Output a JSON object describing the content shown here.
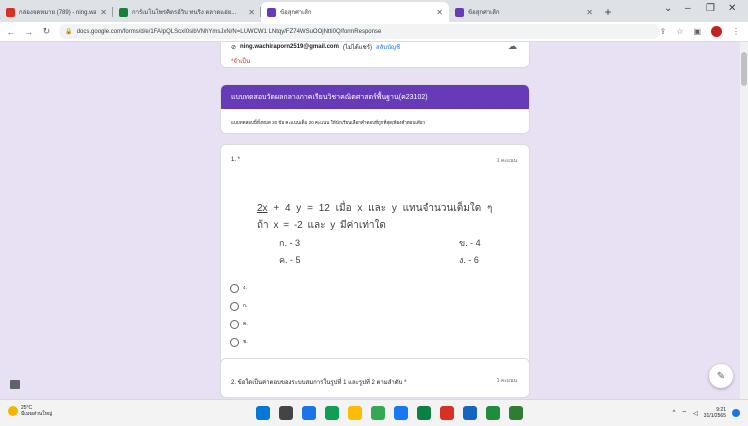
{
  "browser": {
    "tabs": [
      {
        "label": "กล่องจดหมาย (789) - ning.wachi...",
        "color": "#d93025"
      },
      {
        "label": "การ์เมโนโพรคิตรอ์วิบ ทนริง ตลาดแอ่ย...",
        "color": "#188038"
      },
      {
        "label": "ข้อสุกศาเส้ก",
        "color": "#673ab7"
      },
      {
        "label": "ข้อสุกศาเส้ก",
        "color": "#673ab7"
      }
    ],
    "new_tab": "+",
    "url": "docs.google.com/forms/d/e/1FAIpQLScxI0sibVNhYmsJxN/N=LUWCW1 LNtqy/FZ74WSuOOjNtti0Q/formResponse"
  },
  "form": {
    "account_email": "ning.wachiraporn2519@gmail.com",
    "account_note": "(ไม่ได้แชร์)",
    "switch_account": "สลับบัญชี",
    "required_note": "*จำเป็น",
    "title": "แบบทดสอบวัดผลกลางภาคเรียนวิชาคณิตศาสตร์พื้นฐาน(ค23102)",
    "description": "แบบทดสอบนี้ทั้งหมด 20 ข้อ คะแนนเต็ม 20 คะแนน ให้นักเรียนเลือกคำตอบที่ถูกที่สุดเพียงคำตอบเดียว",
    "q1": {
      "number": "1. *",
      "points": "1 คะแนน",
      "eq_under": "2x",
      "eq_rest": "+ 4 y = 12   เมื่อ x และ y แทนจำนวนเต็มใด ๆ",
      "condition": "ถ้า x = -2 และ y มีค่าเท่าใด",
      "opt_a": "ก.  - 3",
      "opt_b": "ข.  - 4",
      "opt_c": "ค.  - 5",
      "opt_d": "ง.  - 6",
      "radios": [
        "ง.",
        "ก.",
        "ค.",
        "ข."
      ]
    },
    "q2": {
      "text": "2. ข้อใดเป็นค่าตอบของระบบสมการในรูปที่ 1 และรูปที่ 2 ตามลำดับ *",
      "points": "1 คะแนน"
    }
  },
  "taskbar": {
    "temp": "25°C",
    "weather": "มีเมฆส่วนใหญ่",
    "time": "9:21",
    "date": "31/1/2565",
    "app_colors": [
      "#0078d4",
      "#444444",
      "#1a73e8",
      "#0f9d58",
      "#fbbc04",
      "#34a853",
      "#1877f2",
      "#0b8043",
      "#d93025",
      "#1565c0",
      "#1e8e3e",
      "#2e7d32"
    ]
  }
}
